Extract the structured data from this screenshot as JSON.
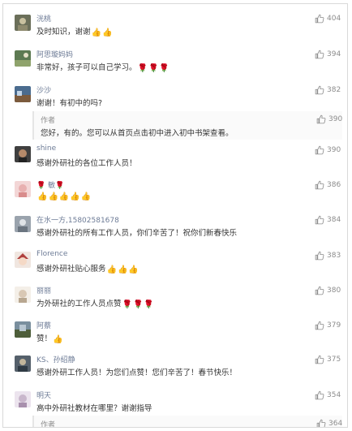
{
  "comments": [
    {
      "name": "洸桃",
      "text": "及时知识，谢谢",
      "emojis": [
        "👍",
        "👍"
      ],
      "likes": "404",
      "avatar_color": "#6b6f5a"
    },
    {
      "name": "阿思璇妈妈",
      "text": "非常好，孩子可以自己学习。",
      "emojis": [
        "🌹",
        "🌹",
        "🌹"
      ],
      "likes": "394",
      "avatar_color": "#5d7a52"
    },
    {
      "name": "沙沙",
      "text": "谢谢！有初中的吗?",
      "emojis": [],
      "likes": "382",
      "avatar_color": "#4b6c8f",
      "reply": {
        "tag": "作者",
        "text": "您好，有的。您可以从首页点击初中进入初中书架查看。",
        "likes": "390"
      }
    },
    {
      "name": "shine",
      "text": "感谢外研社的各位工作人员！",
      "emojis": [],
      "likes": "390",
      "avatar_color": "#3f3f3f"
    },
    {
      "name": "🌹 敏🌹",
      "text": "",
      "emojis": [
        "👍",
        "👍",
        "👍",
        "👍",
        "👍"
      ],
      "likes": "386",
      "avatar_color": "#e8b0b0"
    },
    {
      "name": "在水一方,15802581678",
      "text": "感谢外研社的所有工作人员，你们辛苦了！祝你们新春快乐",
      "emojis": [],
      "likes": "384",
      "avatar_color": "#9aa3ad"
    },
    {
      "name": "Florence",
      "text": "感谢外研社贴心服务",
      "emojis": [
        "👍",
        "👍",
        "👍"
      ],
      "likes": "383",
      "avatar_color": "#b0413e"
    },
    {
      "name": "丽丽",
      "text": "为外研社的工作人员点赞",
      "emojis": [
        "🌹",
        "🌹",
        "🌹"
      ],
      "likes": "380",
      "avatar_color": "#d9c8b4"
    },
    {
      "name": "阿蔡",
      "text": "赞！",
      "emojis": [
        "👍"
      ],
      "likes": "379",
      "avatar_color": "#7a8f9e"
    },
    {
      "name": "KS、孙绍静",
      "text": "感谢外研工作人员！为您们点赞！您们辛苦了！春节快乐！",
      "emojis": [],
      "likes": "375",
      "avatar_color": "#55606b"
    },
    {
      "name": "明天",
      "text": "高中外研社教材在哪里？谢谢指导",
      "emojis": [],
      "likes": "354",
      "avatar_color": "#c9b7cc",
      "reply": {
        "tag": "作者",
        "text": "",
        "likes": "364"
      }
    }
  ],
  "icons": {
    "like": "thumbs-up-icon"
  },
  "colors": {
    "name": "#6d7b96",
    "text": "#333333",
    "muted": "#8c8c8c"
  }
}
